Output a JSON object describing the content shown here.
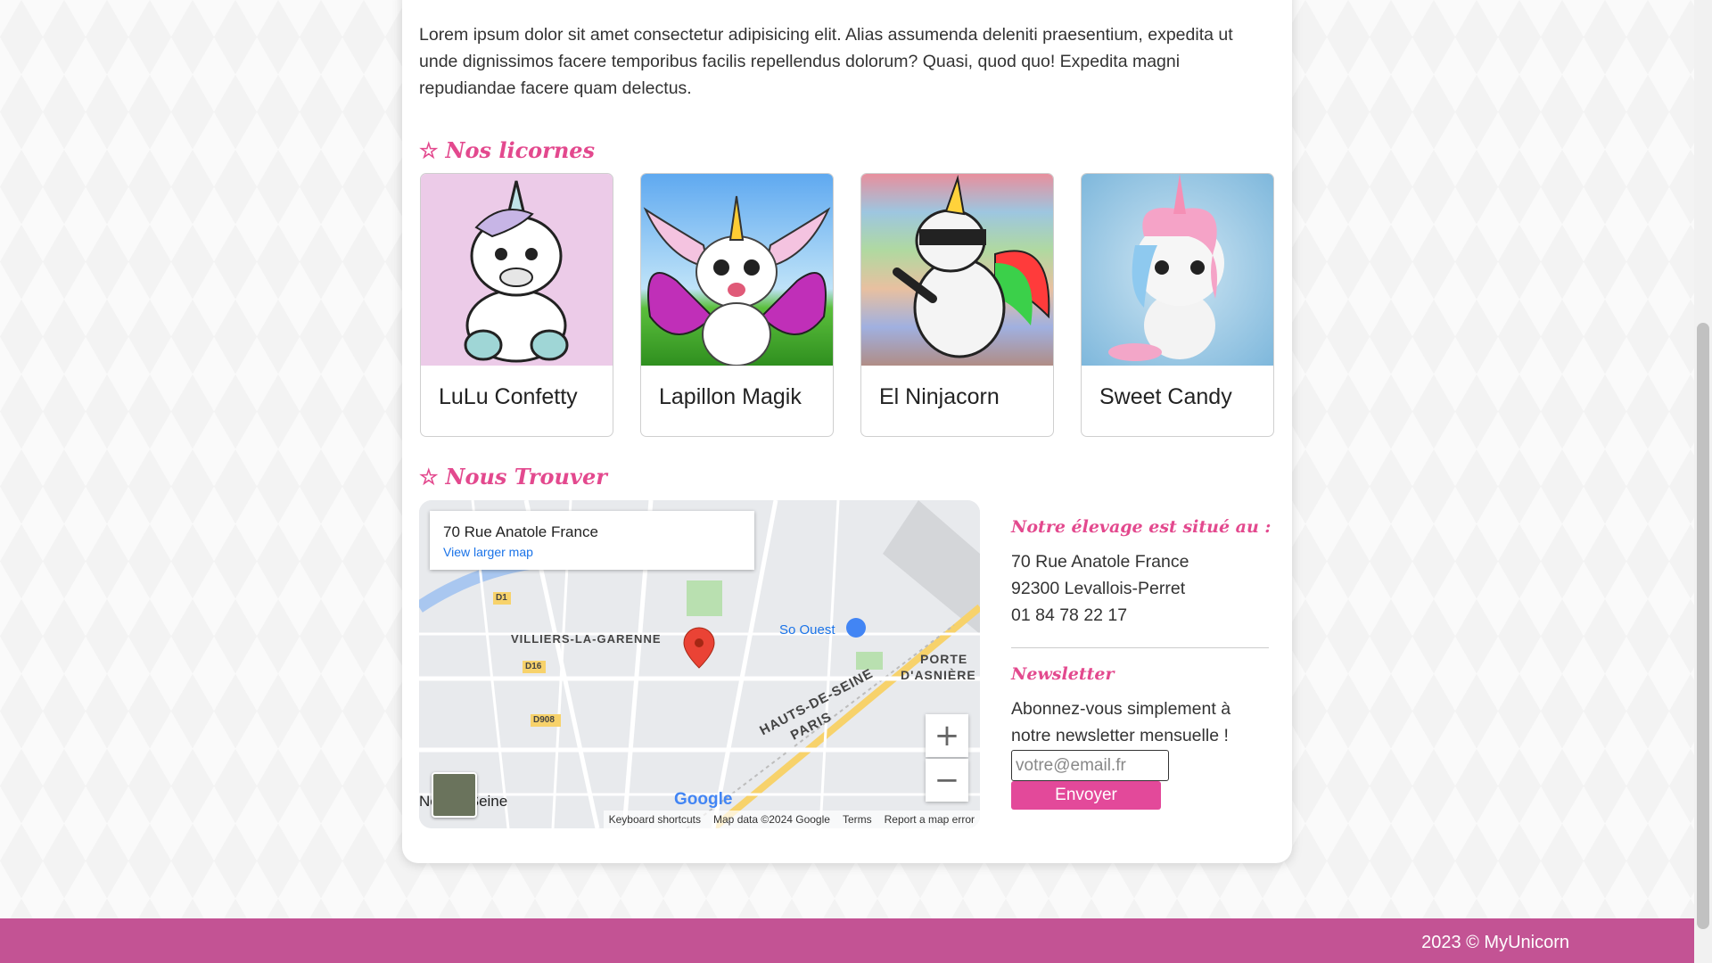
{
  "intro_text": "Lorem ipsum dolor sit amet consectetur adipisicing elit. Alias assumenda deleniti praesentium, expedita ut unde dignissimos facere temporibus facilis repellendus dolorum? Quasi, quod quo! Expedita magni repudiandae facere quam delectus.",
  "sections": {
    "unicorns_title": "Nos licornes",
    "find_us_title": "Nous Trouver"
  },
  "unicorns": [
    {
      "name": "LuLu Confetty",
      "bg": "#eccbe8"
    },
    {
      "name": "Lapillon Magik",
      "bg": "#7ec4f0"
    },
    {
      "name": "El Ninjacorn",
      "bg": "#c9a9a2"
    },
    {
      "name": "Sweet Candy",
      "bg": "#a7d3ea"
    }
  ],
  "map": {
    "info_title": "70 Rue Anatole France",
    "info_link": "View larger map",
    "labels": {
      "villiers": "VILLIERS-LA-GARENNE",
      "hauts": "HAUTS-DE-SEINE",
      "paris": "PARIS",
      "porte": "PORTE",
      "asnieres": "D'ASNIÈRE",
      "so_ouest": "So Ouest",
      "sur_seine": "Ne  sur-Seine",
      "d1": "D1",
      "d16": "D16",
      "d908": "D908"
    },
    "google": "Google",
    "footer": [
      "Keyboard shortcuts",
      "Map data ©2024 Google",
      "Terms",
      "Report a map error"
    ],
    "zoom_in": "+",
    "zoom_out": "−"
  },
  "location": {
    "heading": "Notre élevage est situé au :",
    "street": "70 Rue Anatole France",
    "city": "92300 Levallois-Perret",
    "phone": "01 84 78 22 17"
  },
  "newsletter": {
    "heading": "Newsletter",
    "text": "Abonnez-vous simplement à notre newsletter mensuelle !",
    "placeholder": "votre@email.fr",
    "button": "Envoyer"
  },
  "footer": {
    "text": "2023 © MyUnicorn"
  },
  "colors": {
    "accent": "#e3498e",
    "footer": "#c35394",
    "button": "#e3499a"
  }
}
